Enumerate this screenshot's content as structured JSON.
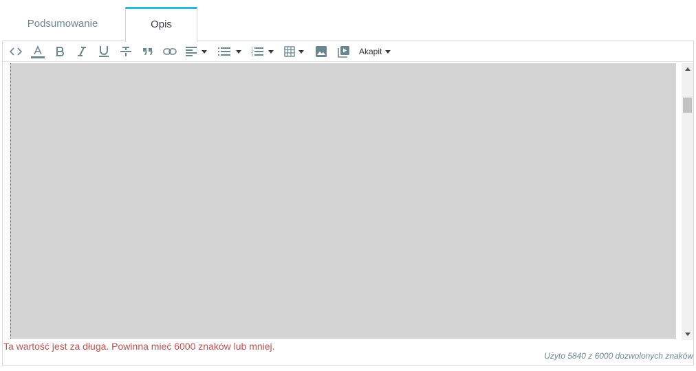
{
  "tabs": [
    {
      "label": "Podsumowanie",
      "active": false
    },
    {
      "label": "Opis",
      "active": true
    }
  ],
  "toolbar": {
    "format_label": "Akapit",
    "icons": [
      "code-icon",
      "text-color-icon",
      "bold-icon",
      "italic-icon",
      "underline-icon",
      "strikethrough-icon",
      "blockquote-icon",
      "link-icon",
      "align-left-icon",
      "bullet-list-icon",
      "numbered-list-icon",
      "table-icon",
      "image-icon",
      "media-icon"
    ]
  },
  "editor": {
    "content": ""
  },
  "validation": {
    "error_message": "Ta wartość jest za długa. Powinna mieć 6000 znaków lub mniej.",
    "counter_text": "Użyto 5840 z 6000 dozwolonych znaków"
  },
  "colors": {
    "accent": "#25b9d7",
    "error": "#c0504d",
    "editor_bg": "#d4d4d4"
  }
}
